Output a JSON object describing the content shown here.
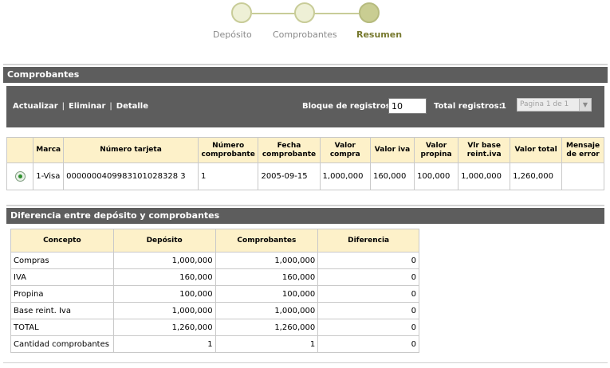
{
  "stepper": {
    "steps": [
      {
        "label": "Depósito"
      },
      {
        "label": "Comprobantes"
      },
      {
        "label": "Resumen"
      }
    ]
  },
  "section_comprobantes": {
    "title": "Comprobantes"
  },
  "toolbar": {
    "actualizar_label": "Actualizar",
    "eliminar_label": "Eliminar",
    "detalle_label": "Detalle",
    "separator": "|",
    "bloque_label": "Bloque de registros:",
    "bloque_value": "10",
    "total_label": "Total registros:",
    "total_value": "1",
    "page_select_value": "Pagina 1 de 1"
  },
  "comprobantes_table": {
    "headers": [
      "Marca",
      "Número tarjeta",
      "Número comprobante",
      "Fecha comprobante",
      "Valor compra",
      "Valor iva",
      "Valor propina",
      "Vlr base reint.iva",
      "Valor total",
      "Mensaje de error"
    ],
    "rows": [
      {
        "selected": true,
        "marca": "1-Visa",
        "numero_tarjeta": "0000000409983101028328 3",
        "numero_comprobante": "1",
        "fecha": "2005-09-15",
        "valor_compra": "1,000,000",
        "valor_iva": "160,000",
        "valor_propina": "100,000",
        "vlr_base": "1,000,000",
        "valor_total": "1,260,000",
        "mensaje_error": ""
      }
    ]
  },
  "section_diferencia": {
    "title": "Diferencia entre depósito y comprobantes"
  },
  "diferencia_table": {
    "headers": [
      "Concepto",
      "Depósito",
      "Comprobantes",
      "Diferencia"
    ],
    "rows": [
      {
        "concepto": "Compras",
        "deposito": "1,000,000",
        "comprobantes": "1,000,000",
        "diferencia": "0"
      },
      {
        "concepto": "IVA",
        "deposito": "160,000",
        "comprobantes": "160,000",
        "diferencia": "0"
      },
      {
        "concepto": "Propina",
        "deposito": "100,000",
        "comprobantes": "100,000",
        "diferencia": "0"
      },
      {
        "concepto": "Base reint. Iva",
        "deposito": "1,000,000",
        "comprobantes": "1,000,000",
        "diferencia": "0"
      },
      {
        "concepto": "TOTAL",
        "deposito": "1,260,000",
        "comprobantes": "1,260,000",
        "diferencia": "0"
      },
      {
        "concepto": "Cantidad comprobantes",
        "deposito": "1",
        "comprobantes": "1",
        "diferencia": "0"
      }
    ]
  }
}
